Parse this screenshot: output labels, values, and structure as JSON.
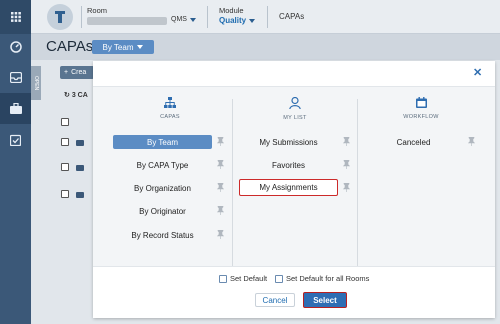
{
  "header": {
    "room_label": "Room",
    "room_value_suffix": "QMS",
    "module_label": "Module",
    "module_value": "Quality",
    "breadcrumb": "CAPAs"
  },
  "page": {
    "title": "CAPAs",
    "view_button_label": "By Team",
    "open_tab_label": "OPEN",
    "create_label": "Crea",
    "count_label": "3 CA"
  },
  "modal": {
    "close_glyph": "✕",
    "columns": [
      {
        "label": "CAPAS",
        "icon": "sitemap-icon",
        "items": [
          "By Team",
          "By CAPA Type",
          "By Organization",
          "By Originator",
          "By Record Status"
        ],
        "selected_index": 0
      },
      {
        "label": "MY LIST",
        "icon": "user-icon",
        "items": [
          "My Submissions",
          "Favorites",
          "My Assignments"
        ]
      },
      {
        "label": "WORKFLOW",
        "icon": "calendar-icon",
        "items": [
          "Canceled"
        ]
      }
    ],
    "set_default_label": "Set Default",
    "set_default_all_label": "Set Default for all Rooms",
    "cancel_label": "Cancel",
    "select_label": "Select"
  },
  "colors": {
    "accent": "#2e6db0",
    "selected_item": "#5b8cc4",
    "highlight_border": "#cc2a2a",
    "rail": "#3b5878"
  }
}
